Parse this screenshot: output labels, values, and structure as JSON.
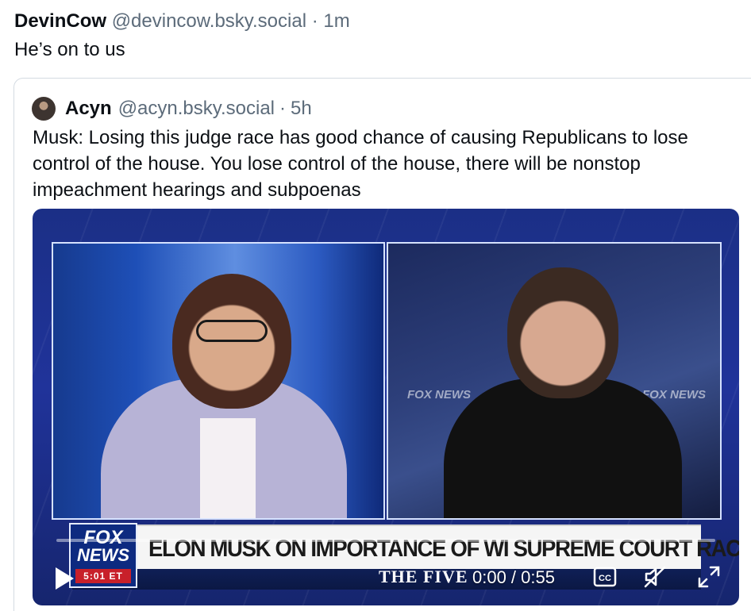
{
  "post": {
    "author_name": "DevinCow",
    "author_handle": "@devincow.bsky.social",
    "separator": "·",
    "time": "1m",
    "text": "He’s on to us"
  },
  "quote": {
    "author_name": "Acyn",
    "author_handle": "@acyn.bsky.social",
    "separator": "·",
    "time": "5h",
    "text": "Musk: Losing this judge race has good chance of causing Republicans to lose control of the house. You lose control of the house, there will be nonstop impeachment hearings and subpoenas"
  },
  "video": {
    "chyron": "ELON MUSK ON IMPORTANCE OF WI SUPREME COURT RACE",
    "network_logo_top": "FOX",
    "network_logo_bottom": "NEWS",
    "on_screen_time": "5:01 ET",
    "show_name": "THE FIVE",
    "background_logo_left": "FOX NEWS",
    "background_logo_right": "FOX NEWS",
    "time_display": "0:00 / 0:55",
    "progress": 0,
    "controls": {
      "play_icon": "play-icon",
      "captions_icon": "closed-captions-icon",
      "mute_icon": "muted-speaker-icon",
      "fullscreen_icon": "fullscreen-icon"
    }
  },
  "colors": {
    "text_primary": "#0b0f14",
    "text_secondary": "#5c6b7a",
    "card_border": "#d4dbe2",
    "fox_blue": "#0d2a80",
    "fox_red": "#c8202a"
  }
}
